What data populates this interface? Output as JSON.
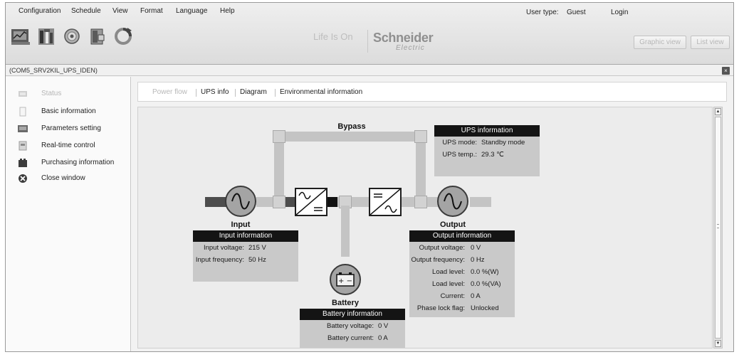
{
  "menu": {
    "items": [
      "Configuration",
      "Schedule",
      "View",
      "Format",
      "Language",
      "Help"
    ],
    "user_type_label": "User type:",
    "user_type_value": "Guest",
    "login": "Login"
  },
  "toolbar": {
    "icons": [
      "chart-icon",
      "tools-icon",
      "disc-icon",
      "exit-door-icon",
      "refresh-icon"
    ]
  },
  "brand": {
    "tagline": "Life Is On",
    "name": "Schneider",
    "sub": "Electric"
  },
  "view_buttons": {
    "graphic": "Graphic view",
    "list": "List view"
  },
  "window": {
    "title": "(COM5_SRV2KIL_UPS_IDEN)"
  },
  "sidebar": {
    "items": [
      {
        "label": "Status",
        "icon": "status-icon",
        "enabled": false
      },
      {
        "label": "Basic information",
        "icon": "document-icon",
        "enabled": true
      },
      {
        "label": "Parameters setting",
        "icon": "parameters-icon",
        "enabled": true
      },
      {
        "label": "Real-time control",
        "icon": "control-icon",
        "enabled": true
      },
      {
        "label": "Purchasing information",
        "icon": "cart-icon",
        "enabled": true
      },
      {
        "label": "Close window",
        "icon": "close-icon",
        "enabled": true
      }
    ]
  },
  "tabs": [
    {
      "label": "Power flow",
      "enabled": false
    },
    {
      "label": "UPS info",
      "enabled": true
    },
    {
      "label": "Diagram",
      "enabled": true
    },
    {
      "label": "Environmental information",
      "enabled": true
    }
  ],
  "diagram": {
    "bypass_label": "Bypass",
    "input_label": "Input",
    "output_label": "Output",
    "battery_label": "Battery",
    "battery_symbols": "+ −"
  },
  "ups_info": {
    "title": "UPS information",
    "rows": [
      {
        "key": "UPS mode:",
        "value": "Standby mode"
      },
      {
        "key": "UPS temp.:",
        "value": "29.3 ℃"
      }
    ]
  },
  "input_info": {
    "title": "Input information",
    "rows": [
      {
        "key": "Input voltage:",
        "value": "215 V"
      },
      {
        "key": "Input frequency:",
        "value": "50 Hz"
      }
    ]
  },
  "output_info": {
    "title": "Output information",
    "rows": [
      {
        "key": "Output voltage:",
        "value": "0 V"
      },
      {
        "key": "Output frequency:",
        "value": "0 Hz"
      },
      {
        "key": "Load level:",
        "value": "0.0 %(W)"
      },
      {
        "key": "Load level:",
        "value": "0.0 %(VA)"
      },
      {
        "key": "Current:",
        "value": "0 A"
      },
      {
        "key": "Phase lock flag:",
        "value": "Unlocked"
      }
    ]
  },
  "battery_info": {
    "title": "Battery information",
    "rows": [
      {
        "key": "Battery voltage:",
        "value": "0 V"
      },
      {
        "key": "Battery current:",
        "value": "0 A"
      }
    ]
  }
}
